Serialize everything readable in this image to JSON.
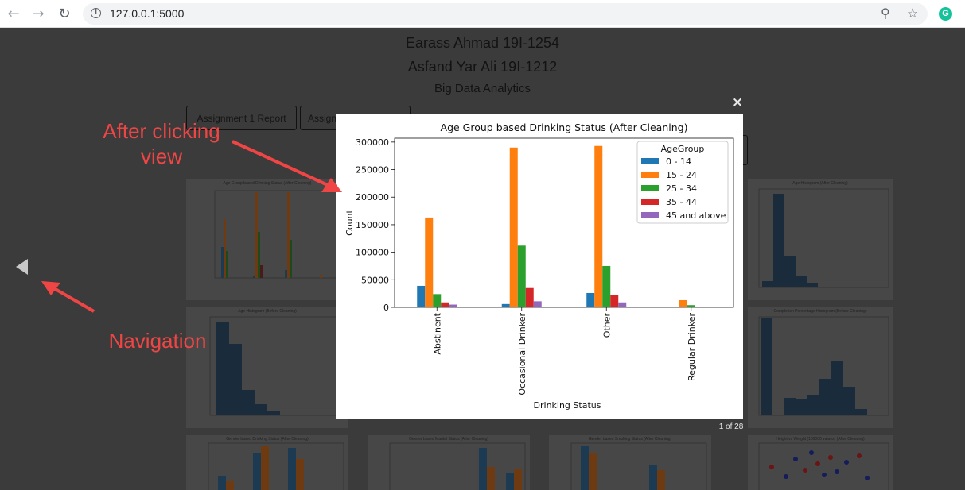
{
  "browser": {
    "url": "127.0.0.1:5000"
  },
  "page": {
    "author1": "Earass Ahmad 19I-1254",
    "author2": "Asfand Yar Ali 19I-1212",
    "course": "Big Data Analytics",
    "buttons": [
      "Assignment 1 Report",
      "Assign"
    ]
  },
  "thumbnails": [
    {
      "title": "Age Group based Drinking Status (After Cleaning)"
    },
    {
      "title": "Age Histogram (After Cleaning)"
    },
    {
      "title": "Age Histogram (Before Cleaning)"
    },
    {
      "title": "Completion Percentage Histogram (Before Cleaning)"
    },
    {
      "title": "Gender based Drinking Status (After Cleaning)"
    },
    {
      "title": "Gender based Marital Status (After Cleaning)"
    },
    {
      "title": "Gender based Smoking Status (After Cleaning)"
    },
    {
      "title": "Height vs Weight (100000 values) (After Cleaning)"
    }
  ],
  "lightbox": {
    "counter": "1 of 28",
    "close_symbol": "×"
  },
  "annotations": {
    "after_clicking": "After clicking",
    "view": "view",
    "navigation": "Navigation"
  },
  "colors": {
    "annotation": "#f04545",
    "series": [
      "#1f77b4",
      "#ff7f0e",
      "#2ca02c",
      "#d62728",
      "#9467bd"
    ]
  },
  "chart_data": {
    "type": "bar",
    "title": "Age Group based Drinking Status (After Cleaning)",
    "xlabel": "Drinking Status",
    "ylabel": "Count",
    "categories": [
      "Abstinent",
      "Occasional Drinker",
      "Other",
      "Regular Drinker"
    ],
    "ylim": [
      0,
      300000
    ],
    "yticks": [
      0,
      50000,
      100000,
      150000,
      200000,
      250000,
      300000
    ],
    "legend_title": "AgeGroup",
    "legend_position": "top-right",
    "series": [
      {
        "name": "0 - 14",
        "values": [
          39000,
          6000,
          26000,
          1000
        ]
      },
      {
        "name": "15 - 24",
        "values": [
          163000,
          290000,
          293000,
          13000
        ]
      },
      {
        "name": "25 - 34",
        "values": [
          24000,
          112000,
          75000,
          4000
        ]
      },
      {
        "name": "35 - 44",
        "values": [
          9000,
          35000,
          23000,
          500
        ]
      },
      {
        "name": "45 and above",
        "values": [
          5000,
          11000,
          9000,
          300
        ]
      }
    ]
  }
}
